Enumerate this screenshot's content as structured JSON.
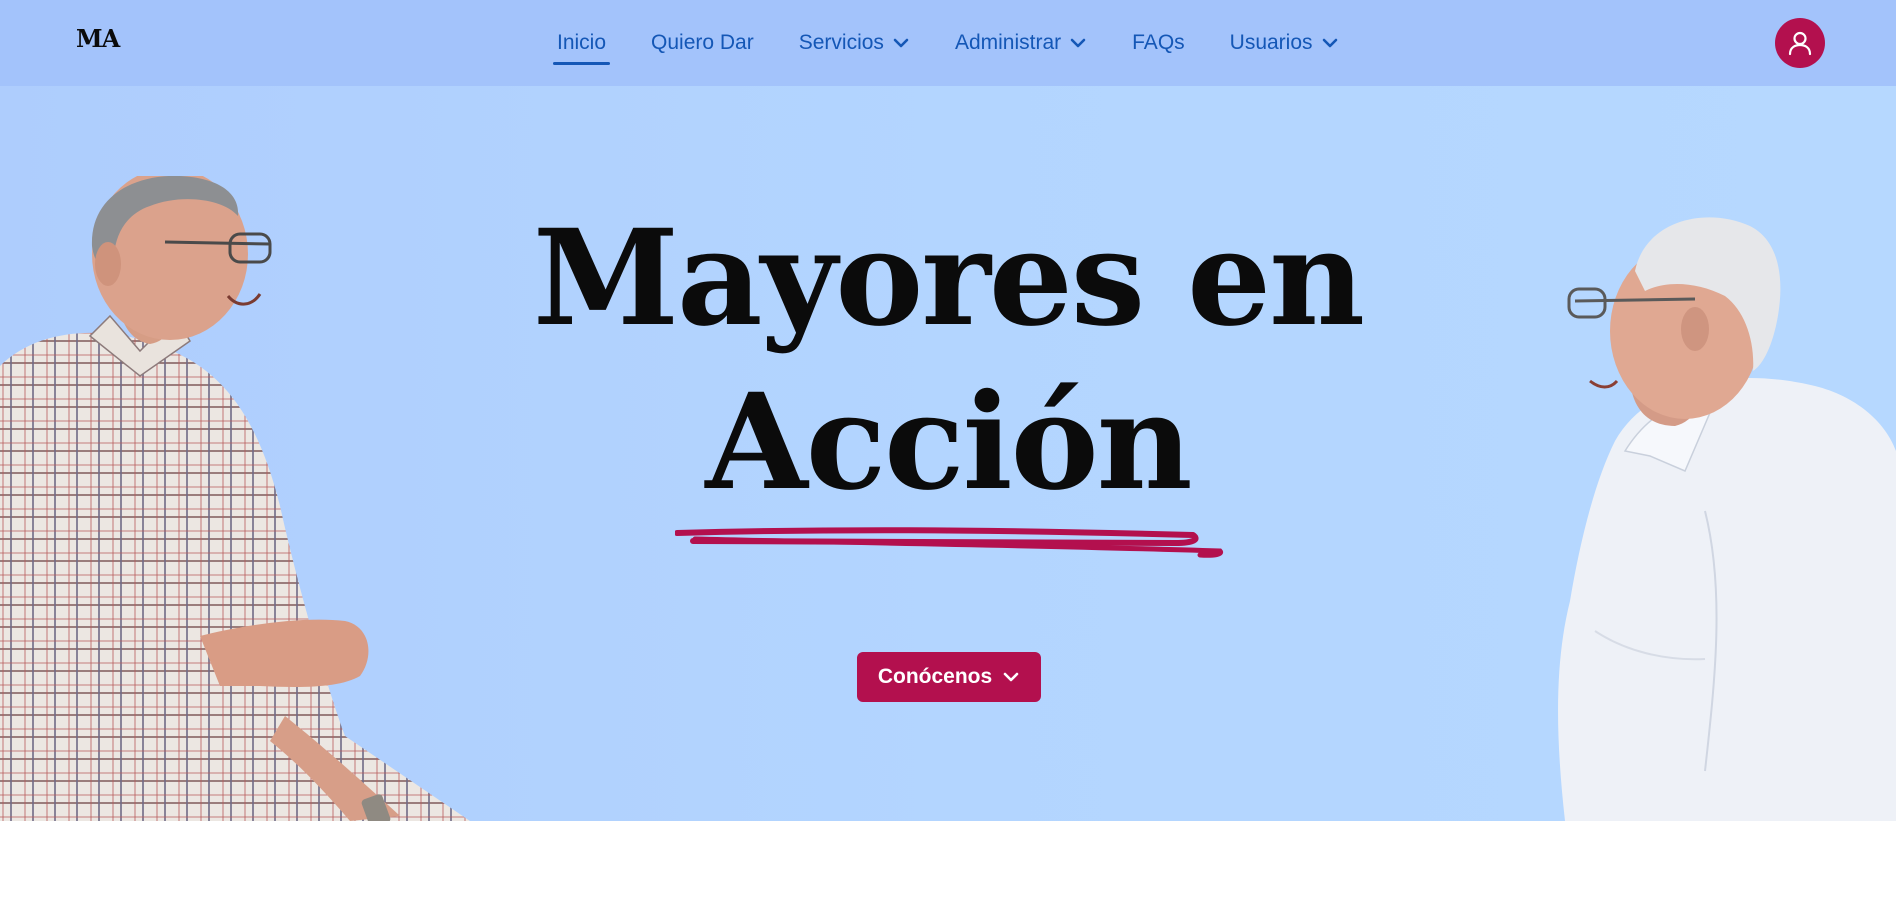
{
  "brand": {
    "logo_text": "MA"
  },
  "nav": {
    "items": [
      {
        "label": "Inicio",
        "active": true,
        "dropdown": false
      },
      {
        "label": "Quiero Dar",
        "active": false,
        "dropdown": false
      },
      {
        "label": "Servicios",
        "active": false,
        "dropdown": true
      },
      {
        "label": "Administrar",
        "active": false,
        "dropdown": true
      },
      {
        "label": "FAQs",
        "active": false,
        "dropdown": false
      },
      {
        "label": "Usuarios",
        "active": false,
        "dropdown": true
      }
    ]
  },
  "user_menu": {
    "icon": "user-icon"
  },
  "hero": {
    "title_line1": "Mayores en",
    "title_line2": "Acción",
    "cta_label": "Conócenos",
    "cta_icon": "chevron-down-icon"
  },
  "colors": {
    "header_bg": "#a3c3fb",
    "hero_bg": "#b3d5ff",
    "nav_text": "#1457b6",
    "accent": "#b3104e",
    "title_text": "#0b0b0b"
  }
}
